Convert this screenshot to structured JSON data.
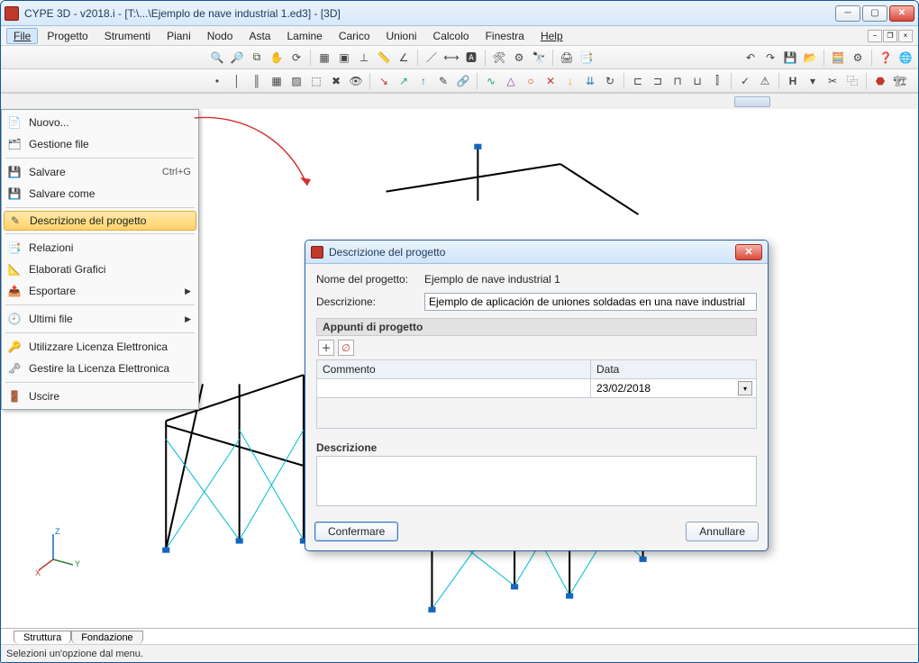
{
  "window": {
    "title": "CYPE 3D - v2018.i - [T:\\...\\Ejemplo de nave industrial 1.ed3] - [3D]"
  },
  "menubar": {
    "items": [
      "File",
      "Progetto",
      "Strumenti",
      "Piani",
      "Nodo",
      "Asta",
      "Lamine",
      "Carico",
      "Unioni",
      "Calcolo",
      "Finestra",
      "Help"
    ]
  },
  "dropdown": {
    "items": [
      {
        "label": "Nuovo...",
        "icon": "new-icon"
      },
      {
        "label": "Gestione file",
        "icon": "files-icon"
      },
      {
        "sep": true
      },
      {
        "label": "Salvare",
        "icon": "save-icon",
        "accel": "Ctrl+G"
      },
      {
        "label": "Salvare come",
        "icon": "saveas-icon"
      },
      {
        "sep": true
      },
      {
        "label": "Descrizione del progetto",
        "icon": "edit-icon",
        "highlight": true
      },
      {
        "sep": true
      },
      {
        "label": "Relazioni",
        "icon": "report-icon"
      },
      {
        "label": "Elaborati Grafici",
        "icon": "drawings-icon"
      },
      {
        "label": "Esportare",
        "icon": "export-icon",
        "submenu": true
      },
      {
        "sep": true
      },
      {
        "label": "Ultimi file",
        "icon": "recent-icon",
        "submenu": true
      },
      {
        "sep": true
      },
      {
        "label": "Utilizzare Licenza Elettronica",
        "icon": "license-use-icon"
      },
      {
        "label": "Gestire la Licenza Elettronica",
        "icon": "license-manage-icon"
      },
      {
        "sep": true
      },
      {
        "label": "Uscire",
        "icon": "exit-icon"
      }
    ]
  },
  "dialog": {
    "title": "Descrizione del progetto",
    "project_name_label": "Nome del progetto:",
    "project_name_value": "Ejemplo de nave industrial 1",
    "description_label": "Descrizione:",
    "description_value": "Ejemplo de aplicación de uniones soldadas en una nave industrial",
    "notes_section": "Appunti di progetto",
    "table": {
      "col_comment": "Commento",
      "col_date": "Data",
      "rows": [
        {
          "comment": "",
          "date": "23/02/2018"
        }
      ]
    },
    "desc_section": "Descrizione",
    "desc_text": "",
    "confirm": "Confermare",
    "cancel": "Annullare"
  },
  "tabs": {
    "structure": "Struttura",
    "foundation": "Fondazione"
  },
  "status": "Selezioni un'opzione dal menu.",
  "gizmo": {
    "x": "X",
    "y": "Y",
    "z": "Z"
  }
}
